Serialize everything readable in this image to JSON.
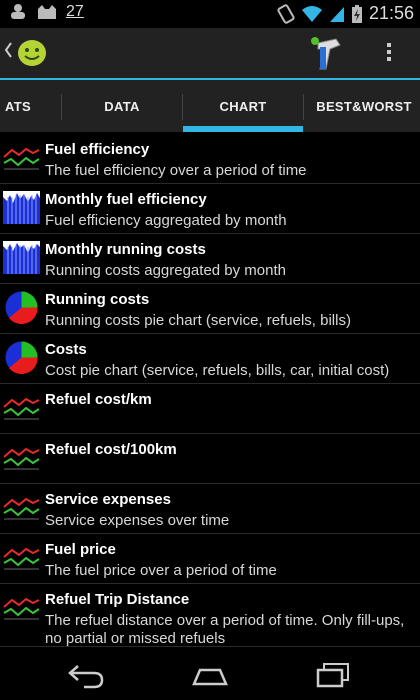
{
  "status_bar": {
    "notification_count": "27",
    "time": "21:56"
  },
  "tabs": [
    {
      "label": "ATS",
      "selected": false
    },
    {
      "label": "DATA",
      "selected": false
    },
    {
      "label": "CHART",
      "selected": true
    },
    {
      "label": "BEST&WORST",
      "selected": false
    }
  ],
  "items": [
    {
      "title": "Fuel efficiency",
      "description": "The fuel efficiency over a period of time",
      "icon": "line-chart-icon"
    },
    {
      "title": "Monthly fuel efficiency",
      "description": "Fuel efficiency aggregated by month",
      "icon": "bar-chart-icon"
    },
    {
      "title": "Monthly running costs",
      "description": "Running costs aggregated by month",
      "icon": "bar-chart-icon"
    },
    {
      "title": "Running costs",
      "description": "Running costs pie chart (service, refuels, bills)",
      "icon": "pie-chart-icon"
    },
    {
      "title": "Costs",
      "description": "Cost pie chart (service, refuels, bills, car, initial cost)",
      "icon": "pie-chart-icon"
    },
    {
      "title": "Refuel cost/km",
      "description": "",
      "icon": "line-chart-icon"
    },
    {
      "title": "Refuel cost/100km",
      "description": "",
      "icon": "line-chart-icon"
    },
    {
      "title": "Service expenses",
      "description": "Service expenses over time",
      "icon": "line-chart-icon"
    },
    {
      "title": "Fuel price",
      "description": "The fuel price over a period of time",
      "icon": "line-chart-icon"
    },
    {
      "title": "Refuel Trip Distance",
      "description": "The refuel distance over a period of time. Only fill-ups, no partial or missed refuels",
      "icon": "line-chart-icon"
    }
  ],
  "colors": {
    "accent": "#33b5e5",
    "bar_blue": "#1a2fd6",
    "pie_red": "#e81c1c",
    "pie_green": "#22c022"
  }
}
